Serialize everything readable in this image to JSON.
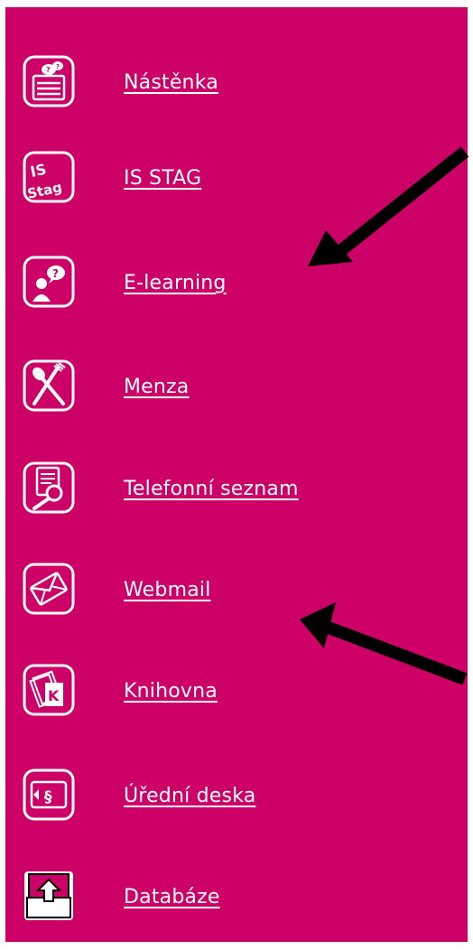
{
  "menu": {
    "items": [
      {
        "label": "Nástěnka",
        "icon": "noticeboard-icon"
      },
      {
        "label": "IS STAG",
        "icon": "is-stag-icon",
        "icon_text_top": "IS",
        "icon_text_bottom": "Stag"
      },
      {
        "label": "E-learning",
        "icon": "e-learning-icon"
      },
      {
        "label": "Menza",
        "icon": "cutlery-icon"
      },
      {
        "label": "Telefonní seznam",
        "icon": "phonebook-search-icon"
      },
      {
        "label": "Webmail",
        "icon": "envelope-icon"
      },
      {
        "label": "Knihovna",
        "icon": "books-icon",
        "icon_text": "K"
      },
      {
        "label": "Úřední deska",
        "icon": "official-board-icon",
        "icon_text": "§"
      },
      {
        "label": "Databáze",
        "icon": "database-upload-icon"
      }
    ]
  },
  "colors": {
    "panel_background": "#cc0066",
    "text": "#ffffff",
    "arrow": "#000000"
  }
}
